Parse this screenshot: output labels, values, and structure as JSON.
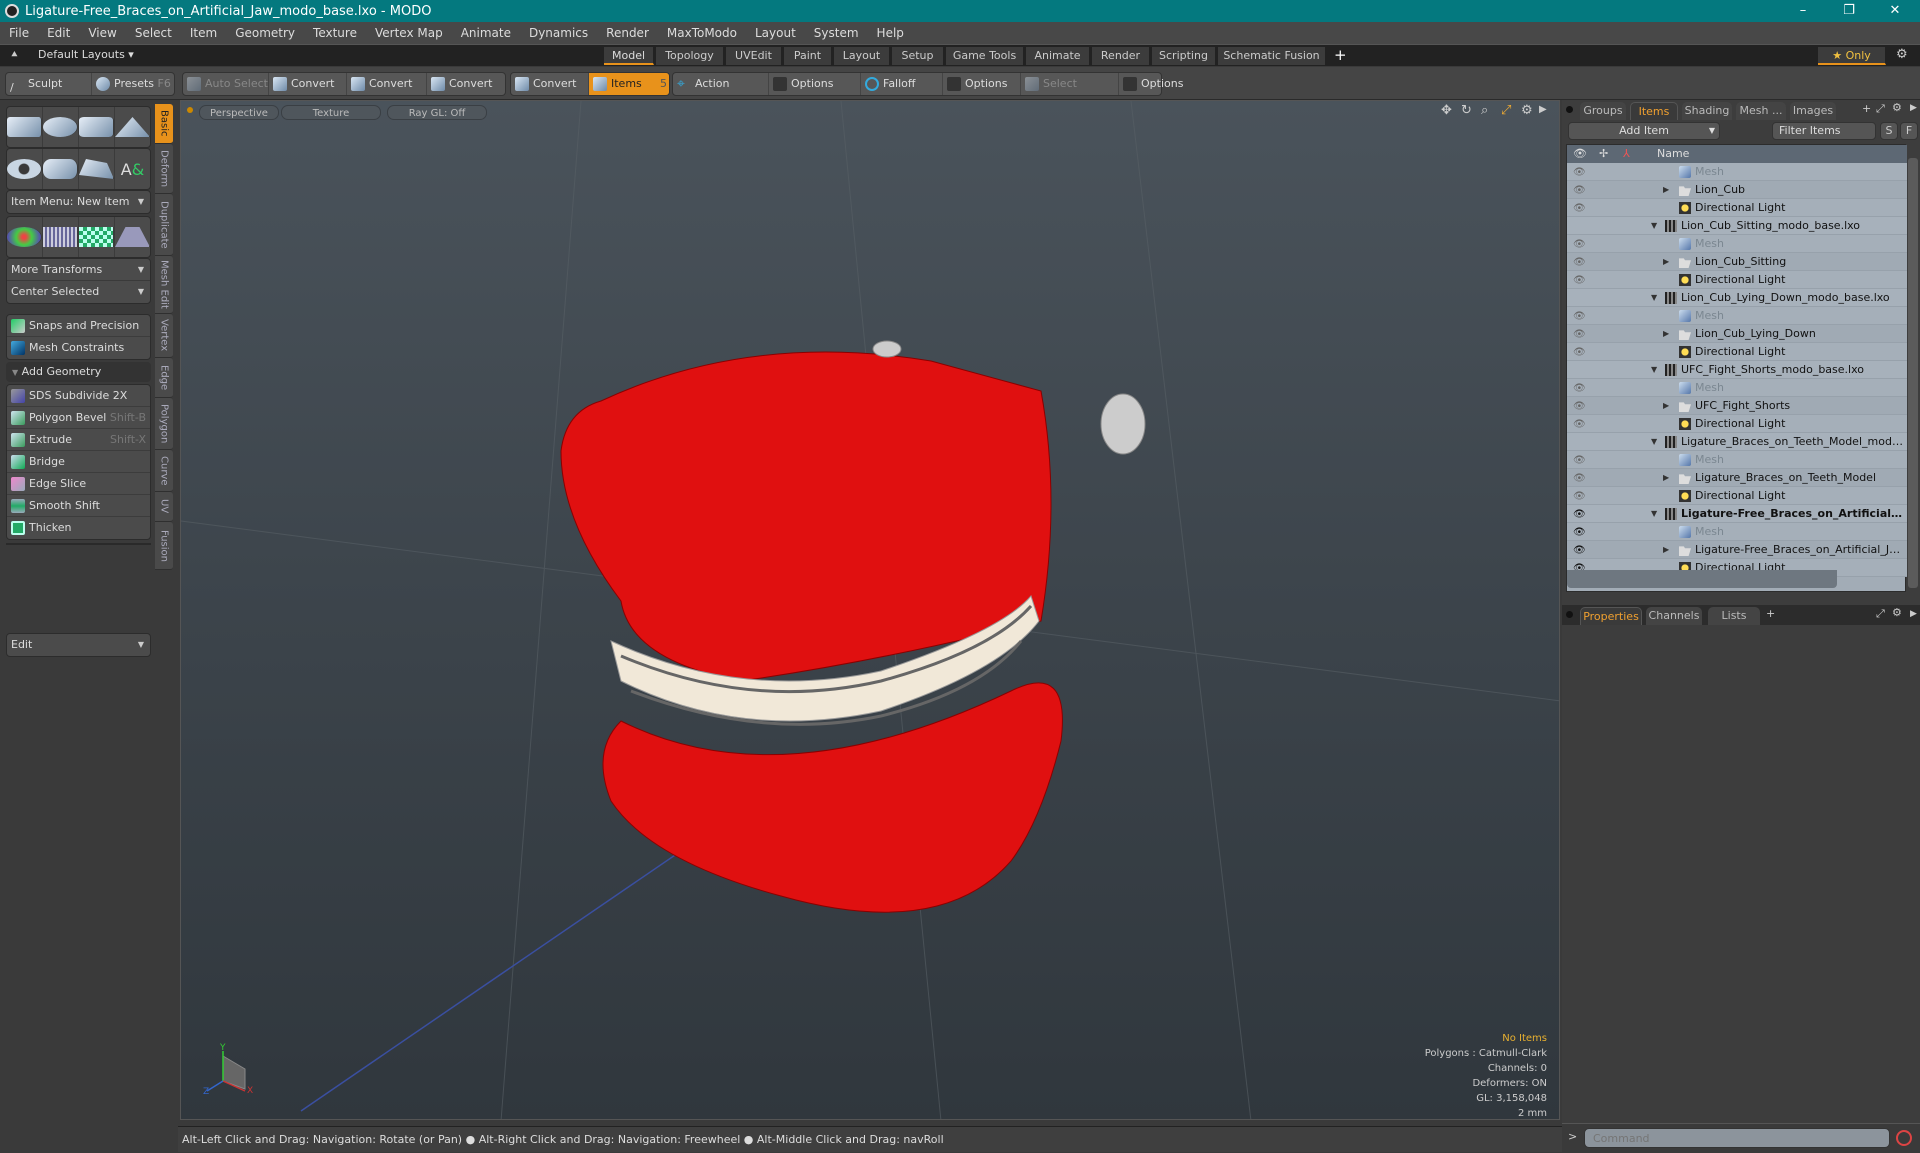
{
  "window": {
    "title": "Ligature-Free_Braces_on_Artificial_Jaw_modo_base.lxo - MODO",
    "min": "–",
    "max": "❐",
    "close": "✕"
  },
  "menu": [
    "File",
    "Edit",
    "View",
    "Select",
    "Item",
    "Geometry",
    "Texture",
    "Vertex Map",
    "Animate",
    "Dynamics",
    "Render",
    "MaxToModo",
    "Layout",
    "System",
    "Help"
  ],
  "layoutbar": {
    "default_layouts": "Default Layouts ▾",
    "tabs": [
      "Model",
      "Topology",
      "UVEdit",
      "Paint",
      "Layout",
      "Setup",
      "Game Tools",
      "Animate",
      "Render",
      "Scripting",
      "Schematic Fusion"
    ],
    "active_tab": "Model",
    "add": "+",
    "only": "★ Only"
  },
  "toolbar": {
    "sculpt": "Sculpt",
    "presets": "Presets",
    "presets_key": "F6",
    "auto_select": "Auto Select",
    "convert1": "Convert",
    "convert2": "Convert",
    "convert3": "Convert",
    "convert4": "Convert",
    "items": "Items",
    "items_key": "5",
    "action_center": "Action Center",
    "options1": "Options",
    "falloff": "Falloff",
    "options2": "Options",
    "select_through": "Select Through",
    "options3": "Options"
  },
  "leftpanel": {
    "item_menu": "Item Menu: New Item",
    "more_transforms": "More Transforms",
    "center_selected": "Center Selected",
    "snaps": "Snaps and Precision",
    "constraints": "Mesh Constraints",
    "add_geometry": "Add Geometry",
    "tools": [
      {
        "label": "SDS Subdivide 2X",
        "shortcut": ""
      },
      {
        "label": "Polygon Bevel",
        "shortcut": "Shift-B"
      },
      {
        "label": "Extrude",
        "shortcut": "Shift-X"
      },
      {
        "label": "Bridge",
        "shortcut": ""
      },
      {
        "label": "Edge Slice",
        "shortcut": ""
      },
      {
        "label": "Smooth Shift",
        "shortcut": ""
      },
      {
        "label": "Thicken",
        "shortcut": ""
      }
    ],
    "edit": "Edit",
    "vtabs": [
      "Basic",
      "Deform",
      "Duplicate",
      "Mesh Edit",
      "Vertex",
      "Edge",
      "Polygon",
      "Curve",
      "UV",
      "Fusion"
    ]
  },
  "viewport": {
    "perspective": "Perspective",
    "texture": "Texture",
    "raygl": "Ray GL: Off",
    "info": {
      "items": "No Items",
      "polygons": "Polygons : Catmull-Clark",
      "channels": "Channels: 0",
      "deformers": "Deformers: ON",
      "gl": "GL: 3,158,048",
      "scale": "2 mm"
    },
    "axis": {
      "x": "X",
      "y": "Y",
      "z": "Z"
    }
  },
  "rightpanel": {
    "tabs": [
      "Groups",
      "Items",
      "Shading",
      "Mesh ...",
      "Images"
    ],
    "active_tab": "Items",
    "add_item": "Add Item",
    "filter": "Filter Items",
    "s": "S",
    "f": "F",
    "name_header": "Name",
    "rows": [
      {
        "name": "Mesh",
        "type": "mesh",
        "level": 2,
        "eye": "dim"
      },
      {
        "name": "Lion_Cub",
        "type": "group",
        "level": 2,
        "eye": "dim",
        "expand": true
      },
      {
        "name": "Directional Light",
        "type": "light",
        "level": 2,
        "eye": "dim"
      },
      {
        "name": "Lion_Cub_Sitting_modo_base.lxo",
        "type": "scene",
        "level": 1,
        "eye": "none"
      },
      {
        "name": "Mesh",
        "type": "mesh",
        "level": 2,
        "eye": "dim"
      },
      {
        "name": "Lion_Cub_Sitting",
        "type": "group",
        "level": 2,
        "eye": "dim",
        "expand": true
      },
      {
        "name": "Directional Light",
        "type": "light",
        "level": 2,
        "eye": "dim"
      },
      {
        "name": "Lion_Cub_Lying_Down_modo_base.lxo",
        "type": "scene",
        "level": 1,
        "eye": "none"
      },
      {
        "name": "Mesh",
        "type": "mesh",
        "level": 2,
        "eye": "dim"
      },
      {
        "name": "Lion_Cub_Lying_Down",
        "type": "group",
        "level": 2,
        "eye": "dim",
        "expand": true
      },
      {
        "name": "Directional Light",
        "type": "light",
        "level": 2,
        "eye": "dim"
      },
      {
        "name": "UFC_Fight_Shorts_modo_base.lxo",
        "type": "scene",
        "level": 1,
        "eye": "none"
      },
      {
        "name": "Mesh",
        "type": "mesh",
        "level": 2,
        "eye": "dim"
      },
      {
        "name": "UFC_Fight_Shorts",
        "type": "group",
        "level": 2,
        "eye": "dim",
        "expand": true
      },
      {
        "name": "Directional Light",
        "type": "light",
        "level": 2,
        "eye": "dim"
      },
      {
        "name": "Ligature_Braces_on_Teeth_Model_modo_b…",
        "type": "scene",
        "level": 1,
        "eye": "none"
      },
      {
        "name": "Mesh",
        "type": "mesh",
        "level": 2,
        "eye": "dim"
      },
      {
        "name": "Ligature_Braces_on_Teeth_Model",
        "type": "group",
        "level": 2,
        "eye": "dim",
        "expand": true
      },
      {
        "name": "Directional Light",
        "type": "light",
        "level": 2,
        "eye": "dim"
      },
      {
        "name": "Ligature-Free_Braces_on_Artificial_ …",
        "type": "scene",
        "level": 1,
        "eye": "on",
        "bold": true
      },
      {
        "name": "Mesh",
        "type": "mesh",
        "level": 2,
        "eye": "on"
      },
      {
        "name": "Ligature-Free_Braces_on_Artificial_Jaw",
        "type": "group",
        "level": 2,
        "eye": "on",
        "expand": true
      },
      {
        "name": "Directional Light",
        "type": "light",
        "level": 2,
        "eye": "on"
      }
    ],
    "prop_tabs": [
      "Properties",
      "Channels",
      "Lists"
    ],
    "active_prop_tab": "Properties",
    "command_placeholder": "Command",
    "prompt": ">"
  },
  "status": {
    "hint1": "Alt-Left Click and Drag: Navigation: Rotate (or Pan)",
    "hint2": "Alt-Right Click and Drag: Navigation: Freewheel",
    "hint3": "Alt-Middle Click and Drag: navRoll"
  },
  "colors": {
    "accent": "#e8921b",
    "title": "#04797f",
    "model": "#e01010"
  }
}
